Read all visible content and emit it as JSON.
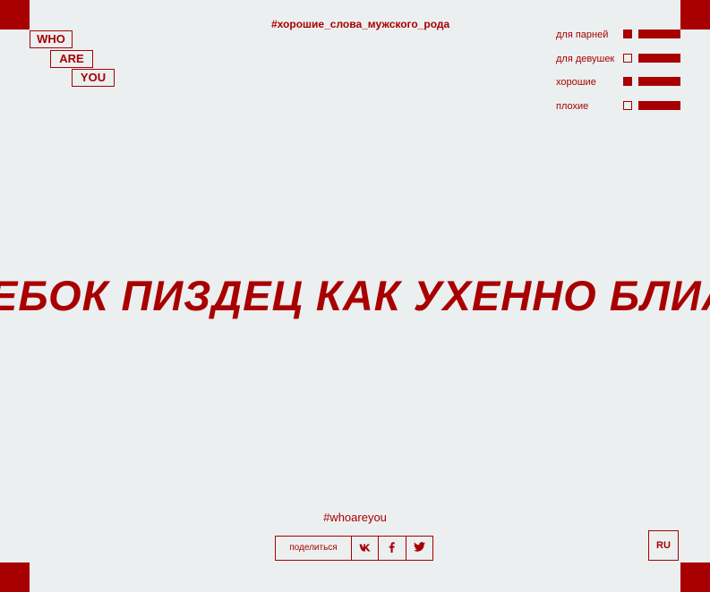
{
  "logo": {
    "line1": "WHO",
    "line2": "ARE",
    "line3": "YOU"
  },
  "header": {
    "hashtag": "#хорошие_слова_мужского_рода"
  },
  "filters": [
    {
      "label": "для парней",
      "checked": true
    },
    {
      "label": "для девушек",
      "checked": false
    },
    {
      "label": "хорошие",
      "checked": true
    },
    {
      "label": "плохие",
      "checked": false
    }
  ],
  "main": {
    "marquee_text": "ЕБОК ПИЗДЕЦ КАК УХЕННО БЛИА"
  },
  "footer": {
    "hashtag": "#whoareyou",
    "share_label": "поделиться",
    "share_buttons": [
      "vk-icon",
      "facebook-icon",
      "twitter-icon"
    ],
    "language": "RU"
  },
  "colors": {
    "accent": "#a80000",
    "background": "#eceff0"
  }
}
